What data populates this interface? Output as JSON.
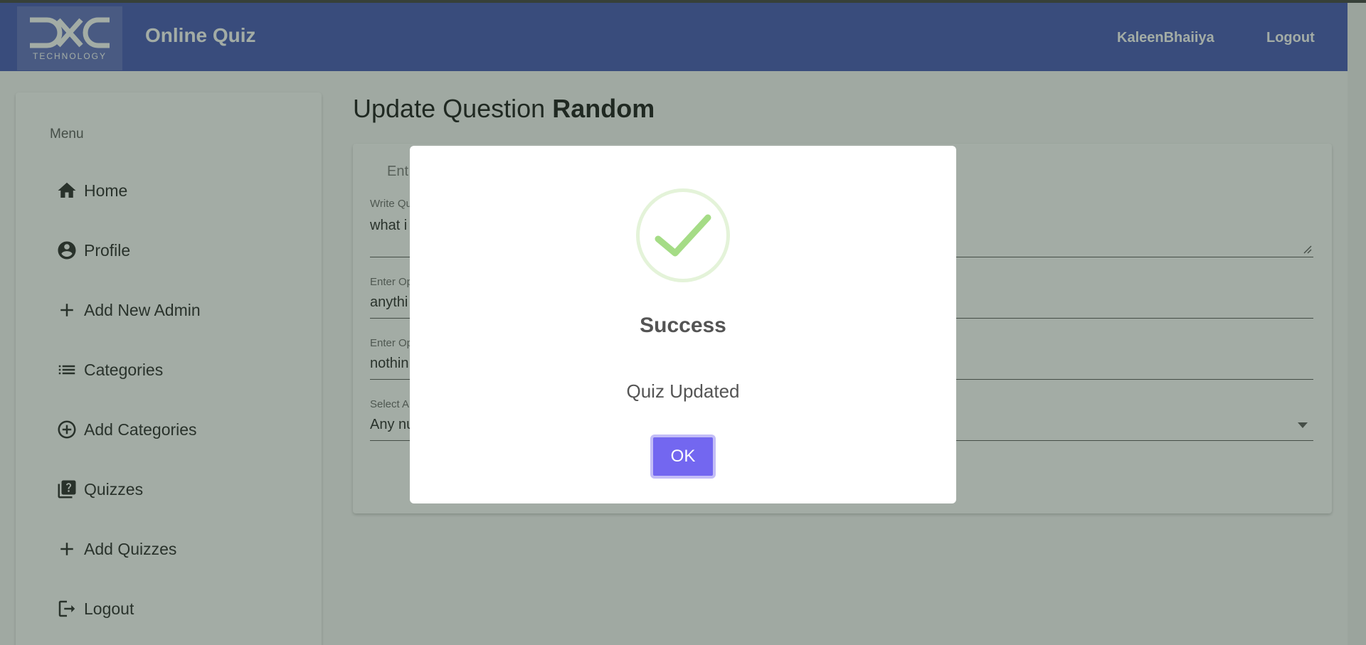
{
  "header": {
    "logo_text": "DXC",
    "logo_sub": "TECHNOLOGY",
    "title": "Online Quiz",
    "username": "KaleenBhaiiya",
    "logout": "Logout"
  },
  "sidebar": {
    "menu_label": "Menu",
    "items": [
      {
        "label": "Home",
        "icon": "home-icon"
      },
      {
        "label": "Profile",
        "icon": "account-circle-icon"
      },
      {
        "label": "Add New Admin",
        "icon": "plus-icon"
      },
      {
        "label": "Categories",
        "icon": "list-icon"
      },
      {
        "label": "Add Categories",
        "icon": "plus-circle-icon"
      },
      {
        "label": "Quizzes",
        "icon": "quiz-icon"
      },
      {
        "label": "Add Quizzes",
        "icon": "plus-icon"
      },
      {
        "label": "Logout",
        "icon": "logout-icon"
      }
    ]
  },
  "main": {
    "title_prefix": "Update Question",
    "title_bold": "Random",
    "card_subtitle": "Ent",
    "fields": [
      {
        "label": "Write Qu",
        "value": "what i"
      },
      {
        "label": "Enter Op",
        "value": "anythi"
      },
      {
        "label": "Enter Op",
        "value": "nothin"
      },
      {
        "label": "Select A",
        "value": "Any nu"
      }
    ]
  },
  "modal": {
    "icon": "check-icon",
    "title": "Success",
    "text": "Quiz Updated",
    "ok_label": "OK"
  },
  "colors": {
    "header_bg": "#3f51b5",
    "overlay": "rgba(50,70,55,0.45)",
    "success_green": "#a5dc86",
    "ok_button": "#7367f0"
  }
}
